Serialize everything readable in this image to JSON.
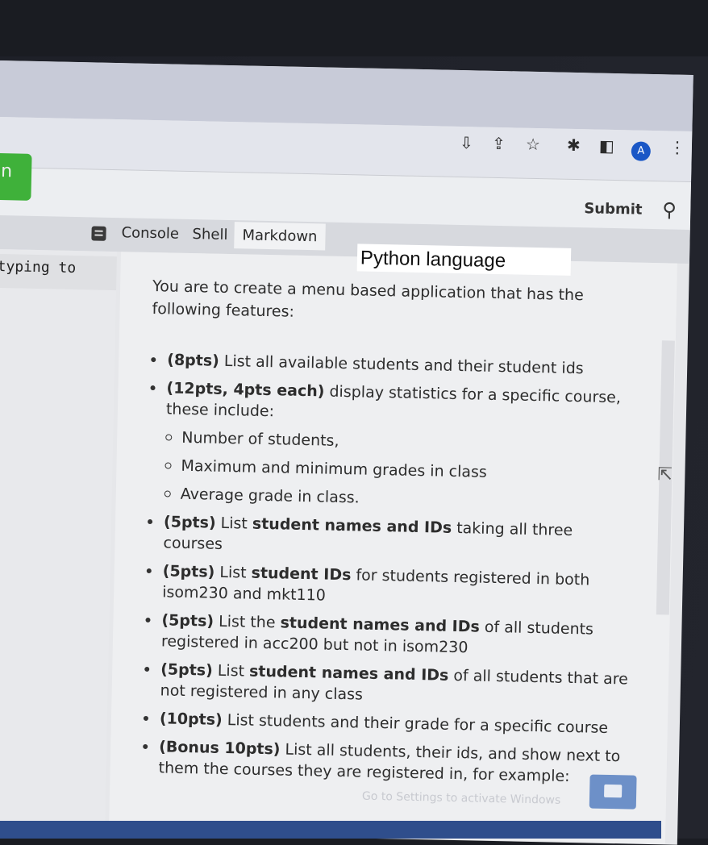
{
  "window": {
    "controls": {
      "dropdown": "⌄",
      "minimize": "—",
      "restore": "❐",
      "close": "✕"
    }
  },
  "toolbar": {
    "avatar_letter": "A",
    "menu": "⋮"
  },
  "appbar": {
    "run_label": "n",
    "submit_label": "Submit",
    "run_color": "#3fb13a"
  },
  "tabs": [
    {
      "label": "Console",
      "active": false
    },
    {
      "label": "Shell",
      "active": false
    },
    {
      "label": "Markdown",
      "active": true
    }
  ],
  "editor": {
    "snippet": "typing to"
  },
  "overlay_label": "Python language",
  "markdown": {
    "intro": "You are to create a menu based application that has the following features:",
    "items": [
      {
        "bold": "(8pts)",
        "rest": " List all available students and their student ids"
      },
      {
        "bold": "(12pts, 4pts each)",
        "rest": " display statistics for a specific course, these include:",
        "sub": [
          "Number of students,",
          "Maximum and minimum grades in class",
          "Average grade in class."
        ]
      },
      {
        "bold": "(5pts)",
        "rest_a": " List ",
        "bold2": "student names and IDs",
        "rest": " taking all three courses"
      },
      {
        "bold": "(5pts)",
        "rest_a": " List ",
        "bold2": "student IDs",
        "rest": " for students registered in both isom230 and mkt110"
      },
      {
        "bold": "(5pts)",
        "rest_a": " List the ",
        "bold2": "student names and IDs",
        "rest": " of all students registered in acc200 but not in isom230"
      },
      {
        "bold": "(5pts)",
        "rest_a": " List ",
        "bold2": "student names and IDs",
        "rest": " of all students that are not registered in any class"
      },
      {
        "bold": "(10pts)",
        "rest": " List students and their grade for a specific course"
      },
      {
        "bold": "(Bonus 10pts)",
        "rest": " List all students, their ids, and show next to them the courses they are registered in, for example:"
      }
    ]
  },
  "watermark": "Go to Settings to activate Windows",
  "accent_blue": "#1a57c6"
}
